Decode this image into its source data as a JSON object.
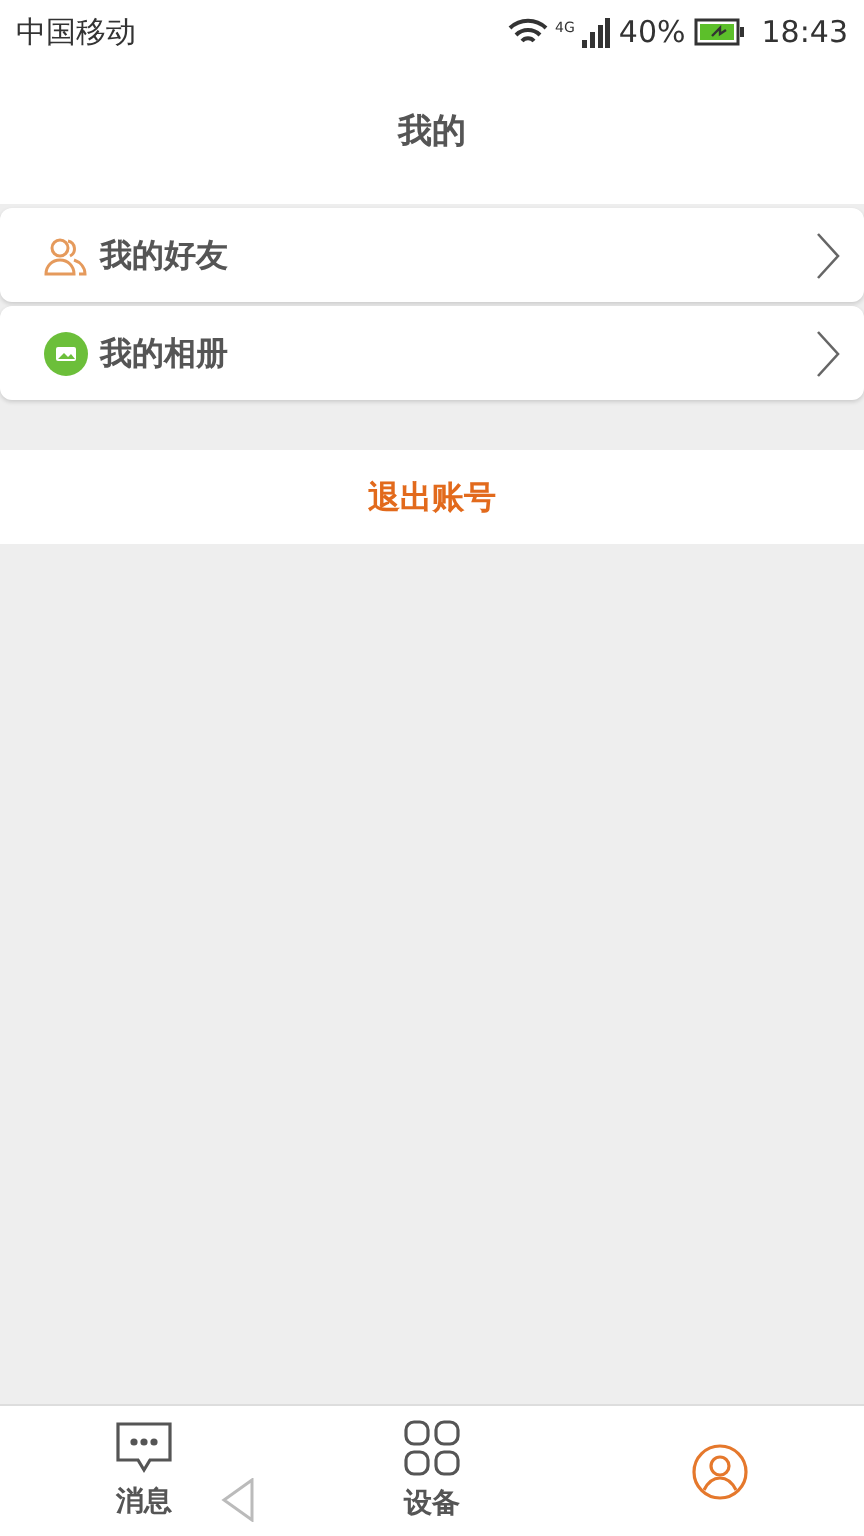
{
  "status_bar": {
    "carrier": "中国移动",
    "network": "4G",
    "battery": "40%",
    "time": "18:43"
  },
  "header": {
    "title": "我的"
  },
  "menu": [
    {
      "kind": "friends",
      "label": "我的好友"
    },
    {
      "kind": "album",
      "label": "我的相册"
    }
  ],
  "logout": {
    "label": "退出账号"
  },
  "tabs": [
    {
      "kind": "message",
      "label": "消息",
      "selected": false
    },
    {
      "kind": "device",
      "label": "设备",
      "selected": false
    },
    {
      "kind": "me",
      "selected": true
    }
  ]
}
